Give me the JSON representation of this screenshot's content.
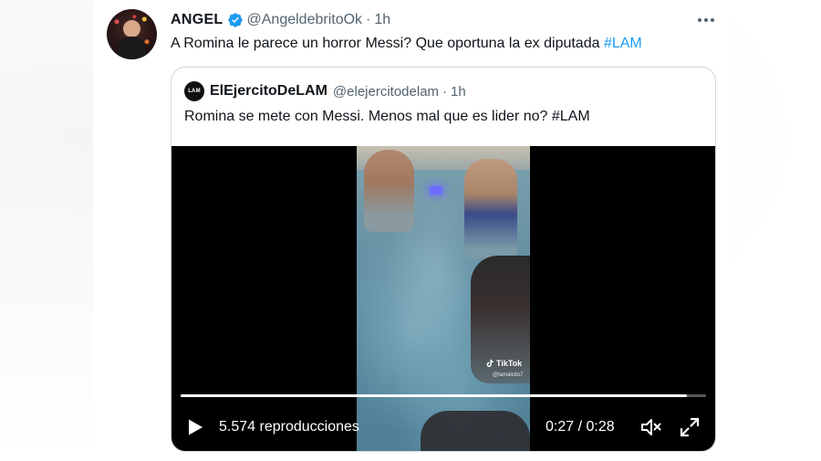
{
  "tweet": {
    "display_name": "ANGEL",
    "handle": "@AngeldebritoOk",
    "separator": "·",
    "time": "1h",
    "text": "A Romina le parece un horror Messi? Que oportuna la ex diputada ",
    "hashtag": "#LAM",
    "icons": {
      "verified": "verified-badge-icon",
      "more": "more-options-icon"
    }
  },
  "quote": {
    "avatar_text": "LAM",
    "display_name": "ElEjercitoDeLAM",
    "handle": "@elejercitodelam",
    "separator": "·",
    "time": "1h",
    "text": "Romina se mete con Messi. Menos mal que es lider no? #LAM"
  },
  "video": {
    "watermark": "TikTok",
    "watermark_handle": "@tamalcito7",
    "views": "5.574 reproducciones",
    "duration": "0:27 / 0:28",
    "progress": 0.964,
    "icons": {
      "play": "play-icon",
      "volume": "volume-icon",
      "fullscreen": "fullscreen-icon"
    }
  },
  "colors": {
    "accent": "#1d9bf0",
    "text": "#0f1419",
    "secondary_text": "#536471",
    "border": "#cfd9de"
  }
}
